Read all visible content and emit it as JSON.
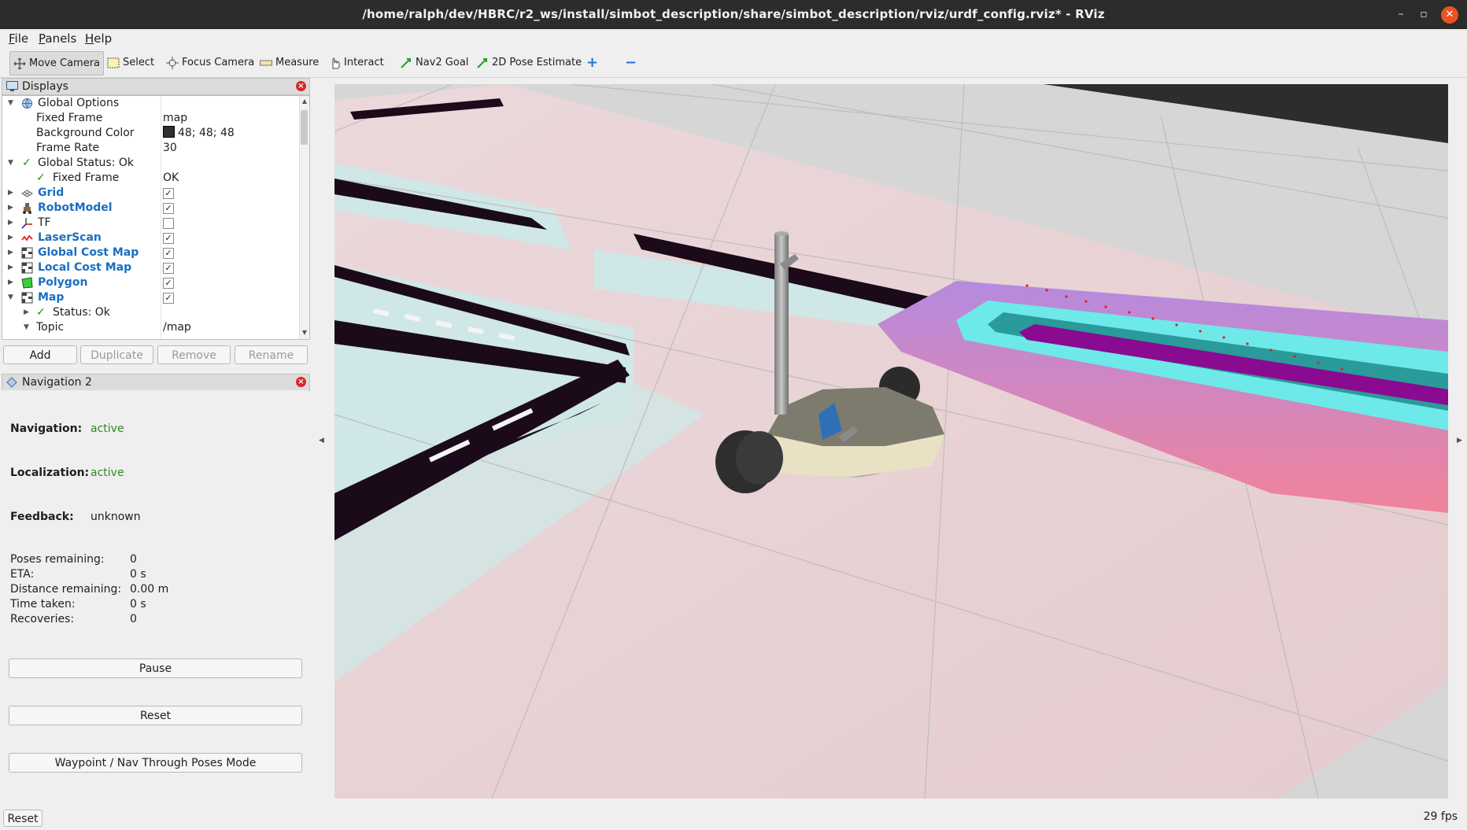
{
  "window": {
    "title": "/home/ralph/dev/HBRC/r2_ws/install/simbot_description/share/simbot_description/rviz/urdf_config.rviz* - RViz",
    "minimize": "–",
    "maximize": "▫",
    "close": "✕"
  },
  "menu": [
    "File",
    "Panels",
    "Help"
  ],
  "toolbar": {
    "tools": [
      "Move Camera",
      "Select",
      "Focus Camera",
      "Measure",
      "Interact",
      "Nav2 Goal",
      "2D Pose Estimate"
    ],
    "active_tool": "Move Camera",
    "add_tool": "+",
    "remove_tool": "−"
  },
  "displays_panel": {
    "title": "Displays",
    "rows": [
      {
        "label": "Global Options",
        "value": ""
      },
      {
        "label": "Fixed Frame",
        "value": "map"
      },
      {
        "label": "Background Color",
        "value": "48; 48; 48"
      },
      {
        "label": "Frame Rate",
        "value": "30"
      },
      {
        "label": "Global Status: Ok",
        "value": ""
      },
      {
        "label": "Fixed Frame",
        "value": "OK"
      },
      {
        "label": "Grid",
        "value": "",
        "checked": true
      },
      {
        "label": "RobotModel",
        "value": "",
        "checked": true
      },
      {
        "label": "TF",
        "value": "",
        "checked": false
      },
      {
        "label": "LaserScan",
        "value": "",
        "checked": true
      },
      {
        "label": "Global Cost Map",
        "value": "",
        "checked": true
      },
      {
        "label": "Local Cost Map",
        "value": "",
        "checked": true
      },
      {
        "label": "Polygon",
        "value": "",
        "checked": true
      },
      {
        "label": "Map",
        "value": "",
        "checked": true
      },
      {
        "label": "Status: Ok",
        "value": ""
      },
      {
        "label": "Topic",
        "value": "/map"
      }
    ],
    "buttons": {
      "add": "Add",
      "duplicate": "Duplicate",
      "remove": "Remove",
      "rename": "Rename"
    }
  },
  "navigation_panel": {
    "title": "Navigation 2",
    "navigation_label": "Navigation:",
    "navigation_value": "active",
    "localization_label": "Localization:",
    "localization_value": "active",
    "feedback_label": "Feedback:",
    "feedback_value": "unknown",
    "stats": [
      {
        "label": "Poses remaining:",
        "value": "0"
      },
      {
        "label": "ETA:",
        "value": "0 s"
      },
      {
        "label": "Distance remaining:",
        "value": "0.00 m"
      },
      {
        "label": "Time taken:",
        "value": "0 s"
      },
      {
        "label": "Recoveries:",
        "value": "0"
      }
    ],
    "pause_button": "Pause",
    "reset_button": "Reset",
    "waypoint_button": "Waypoint / Nav Through Poses Mode"
  },
  "statusbar": {
    "reset_button": "Reset",
    "fps": "29 fps"
  },
  "colors": {
    "check_green": "#1a8f1a",
    "display_blue": "#1b6ec2",
    "costmap_cyan": "#6ee9ea",
    "costmap_purple": "#a97bd6",
    "obstacle": "#1b0a1a"
  }
}
